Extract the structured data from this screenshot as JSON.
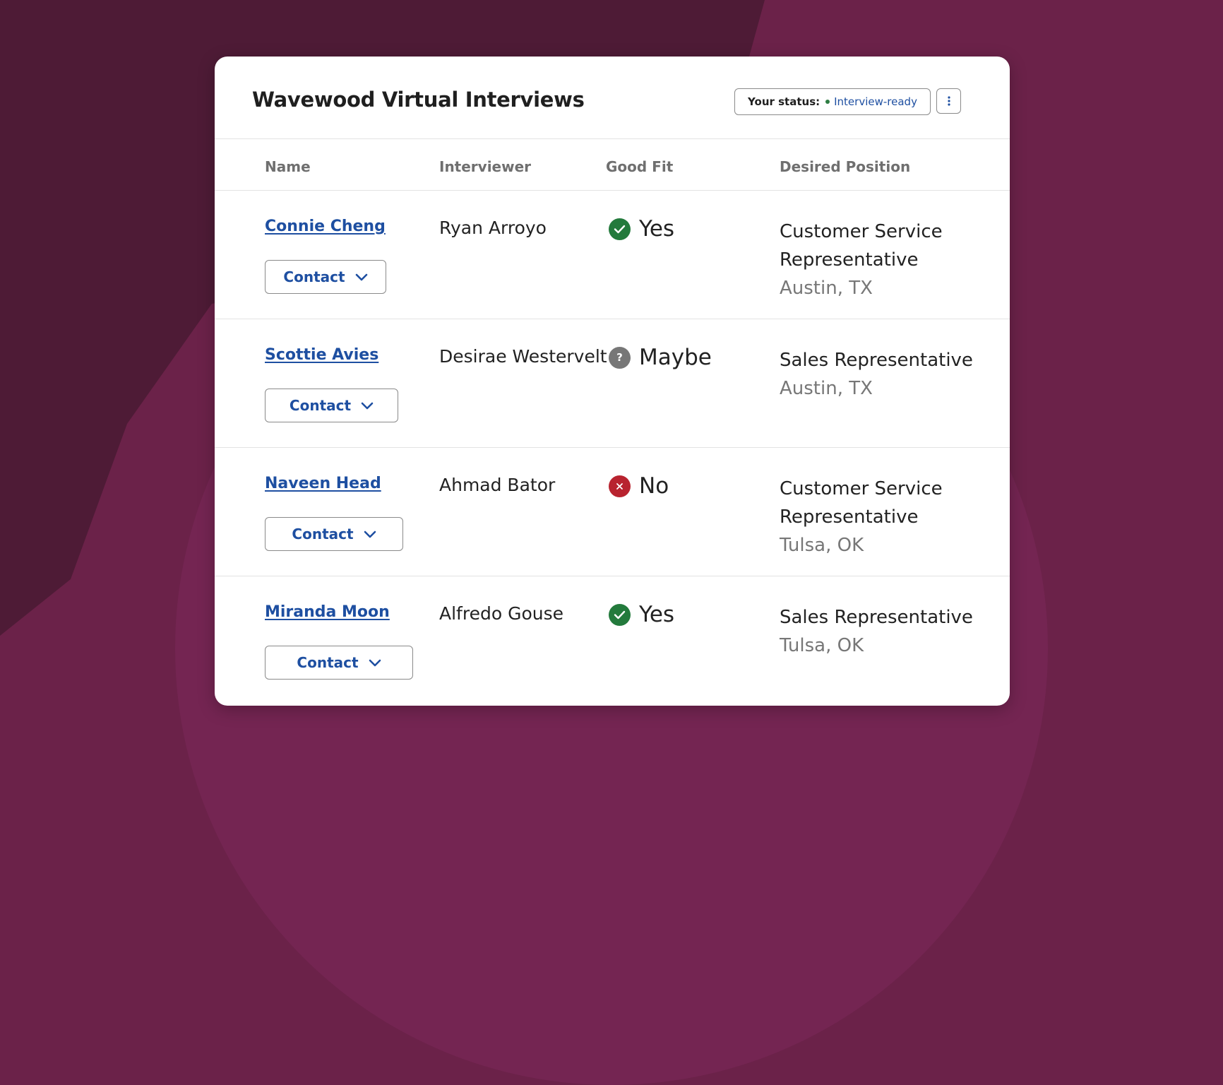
{
  "card": {
    "title": "Wavewood Virtual Interviews",
    "status_label": "Your status:",
    "status_value": "Interview-ready"
  },
  "columns": [
    "Name",
    "Interviewer",
    "Good Fit",
    "Desired Position"
  ],
  "rows": [
    {
      "name": "Connie Cheng",
      "contact_label": "Contact",
      "interviewer": "Ryan Arroyo",
      "fit": "Yes",
      "fit_status": "yes",
      "position": "Customer Service Representative",
      "location": "Austin, TX"
    },
    {
      "name": "Scottie Avies",
      "contact_label": "Contact",
      "interviewer": "Desirae Westervelt",
      "fit": "Maybe",
      "fit_status": "maybe",
      "position": "Sales Representative",
      "location": "Austin, TX"
    },
    {
      "name": "Naveen Head",
      "contact_label": "Contact",
      "interviewer": "Ahmad Bator",
      "fit": "No",
      "fit_status": "no",
      "position": "Customer Service Representative",
      "location": "Tulsa, OK"
    },
    {
      "name": "Miranda Moon",
      "contact_label": "Contact",
      "interviewer": "Alfredo Gouse",
      "fit": "Yes",
      "fit_status": "yes",
      "position": "Sales Representative",
      "location": "Tulsa, OK"
    }
  ],
  "colors": {
    "background": "#6b2249",
    "link": "#1e4fa1",
    "fit_yes": "#237a3c",
    "fit_maybe": "#777777",
    "fit_no": "#b8232f"
  },
  "icons": {
    "yes": "check-circle-icon",
    "maybe": "question-circle-icon",
    "no": "x-circle-icon",
    "contact": "chevron-down-icon",
    "menu": "kebab-menu-icon"
  }
}
